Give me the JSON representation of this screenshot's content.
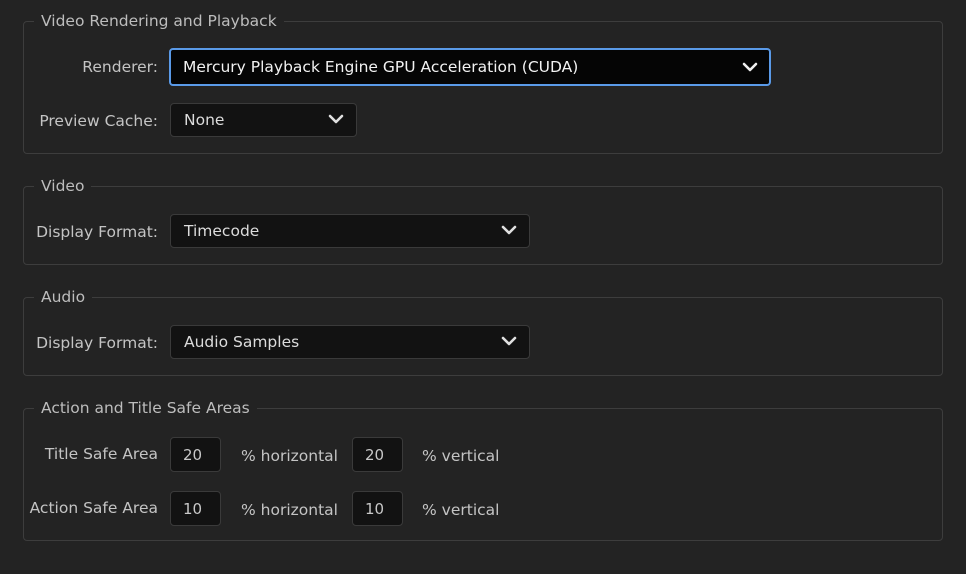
{
  "rendering": {
    "legend": "Video Rendering and Playback",
    "renderer_label": "Renderer:",
    "renderer_value": "Mercury Playback Engine GPU Acceleration (CUDA)",
    "preview_cache_label": "Preview Cache:",
    "preview_cache_value": "None"
  },
  "video": {
    "legend": "Video",
    "display_format_label": "Display Format:",
    "display_format_value": "Timecode"
  },
  "audio": {
    "legend": "Audio",
    "display_format_label": "Display Format:",
    "display_format_value": "Audio Samples"
  },
  "safe_areas": {
    "legend": "Action and Title Safe Areas",
    "title_label": "Title Safe Area",
    "title_horizontal": "20",
    "title_vertical": "20",
    "action_label": "Action Safe Area",
    "action_horizontal": "10",
    "action_vertical": "10",
    "horizontal_unit": "% horizontal",
    "vertical_unit": "% vertical"
  },
  "colors": {
    "background": "#232323",
    "focus_accent": "#5a9ae8",
    "field_background": "#121212"
  },
  "icons": {
    "dropdown": "chevron-down-icon"
  }
}
